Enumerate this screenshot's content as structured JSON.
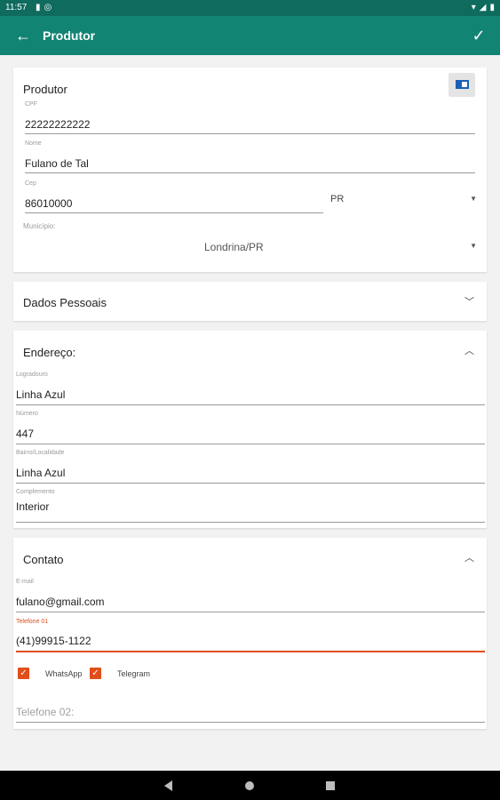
{
  "status_bar": {
    "time": "11:57",
    "left_icons": [
      "sd-card-icon",
      "sync-icon"
    ],
    "right_icons": [
      "wifi-icon",
      "signal-icon",
      "battery-icon"
    ]
  },
  "app_bar": {
    "title": "Produtor",
    "back_glyph": "←",
    "confirm_glyph": "✓"
  },
  "produtor_card": {
    "title": "Produtor",
    "cpf": {
      "label": "CPF",
      "value": "22222222222"
    },
    "nome": {
      "label": "Nome",
      "value": "Fulano de Tal"
    },
    "cep": {
      "label": "Cep",
      "value": "86010000"
    },
    "uf": {
      "value": "PR"
    },
    "municipio": {
      "label": "Município:",
      "value": "Londrina/PR"
    }
  },
  "dados_pessoais": {
    "title": "Dados Pessoais",
    "expanded": false
  },
  "endereco": {
    "title": "Endereço:",
    "expanded": true,
    "logradouro": {
      "label": "Logradouro",
      "value": "Linha Azul"
    },
    "numero": {
      "label": "Número",
      "value": "447"
    },
    "bairro": {
      "label": "Bairro/Localidade",
      "value": "Linha Azul"
    },
    "complemento": {
      "label": "Complemento",
      "value": "Interior"
    }
  },
  "contato": {
    "title": "Contato",
    "expanded": true,
    "email": {
      "label": "E-mail",
      "value": "fulano@gmail.com"
    },
    "telefone1": {
      "label": "Telefone 01",
      "value": "(41)99915-1122"
    },
    "whatsapp": {
      "label": "WhatsApp",
      "checked": true
    },
    "telegram": {
      "label": "Telegram",
      "checked": true
    },
    "telefone2": {
      "placeholder": "Telefone 02:"
    }
  },
  "colors": {
    "primary": "#128474",
    "status_bar": "#0e6b5e",
    "accent": "#e04e1a",
    "background": "#f2f2f2"
  }
}
